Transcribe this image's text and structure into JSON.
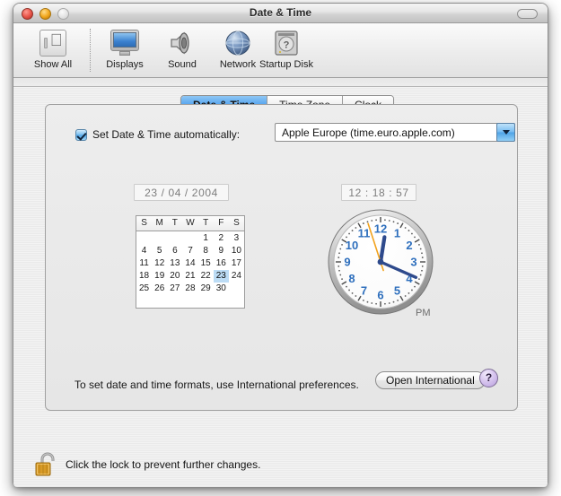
{
  "window": {
    "title": "Date & Time",
    "traffic_lights": [
      "close",
      "minimize",
      "zoom"
    ],
    "toolbar_toggle": "toolbar-toggle"
  },
  "toolbar": {
    "items": [
      {
        "label": "Show All",
        "icon": "show-all-icon"
      },
      {
        "label": "Displays",
        "icon": "displays-icon"
      },
      {
        "label": "Sound",
        "icon": "sound-icon"
      },
      {
        "label": "Network",
        "icon": "network-icon"
      },
      {
        "label": "Startup Disk",
        "icon": "startup-disk-icon"
      }
    ]
  },
  "tabs": [
    {
      "label": "Date & Time",
      "active": true
    },
    {
      "label": "Time Zone",
      "active": false
    },
    {
      "label": "Clock",
      "active": false
    }
  ],
  "auto_row": {
    "checkbox_checked": true,
    "label": "Set Date & Time automatically:",
    "server_value": "Apple Europe (time.euro.apple.com)",
    "arrow_icon": "chevron-down-icon"
  },
  "fields": {
    "date_value": "23 / 04 / 2004",
    "time_value": "12 : 18 : 57"
  },
  "calendar": {
    "weekday_headers": [
      "S",
      "M",
      "T",
      "W",
      "T",
      "F",
      "S"
    ],
    "weeks": [
      [
        "",
        "",
        "",
        "",
        "1",
        "2",
        "3"
      ],
      [
        "4",
        "5",
        "6",
        "7",
        "8",
        "9",
        "10"
      ],
      [
        "11",
        "12",
        "13",
        "14",
        "15",
        "16",
        "17"
      ],
      [
        "18",
        "19",
        "20",
        "21",
        "22",
        "23",
        "24"
      ],
      [
        "25",
        "26",
        "27",
        "28",
        "29",
        "30",
        ""
      ]
    ],
    "selected_day": "23"
  },
  "clock": {
    "hour_numerals": [
      "12",
      "1",
      "2",
      "3",
      "4",
      "5",
      "6",
      "7",
      "8",
      "9",
      "10",
      "11"
    ],
    "hours": 12,
    "minutes": 18,
    "seconds": 57,
    "meridiem": "PM",
    "hand_color": "#2e4a8c",
    "second_hand_color": "#f2a21c",
    "numeral_color": "#2e6fbd"
  },
  "bottom": {
    "help_text": "To set date and time formats, use International preferences.",
    "open_international_label": "Open International",
    "help_button_label": "?"
  },
  "footer": {
    "lock_icon": "unlocked-padlock-icon",
    "lock_text": "Click the lock to prevent further changes."
  }
}
